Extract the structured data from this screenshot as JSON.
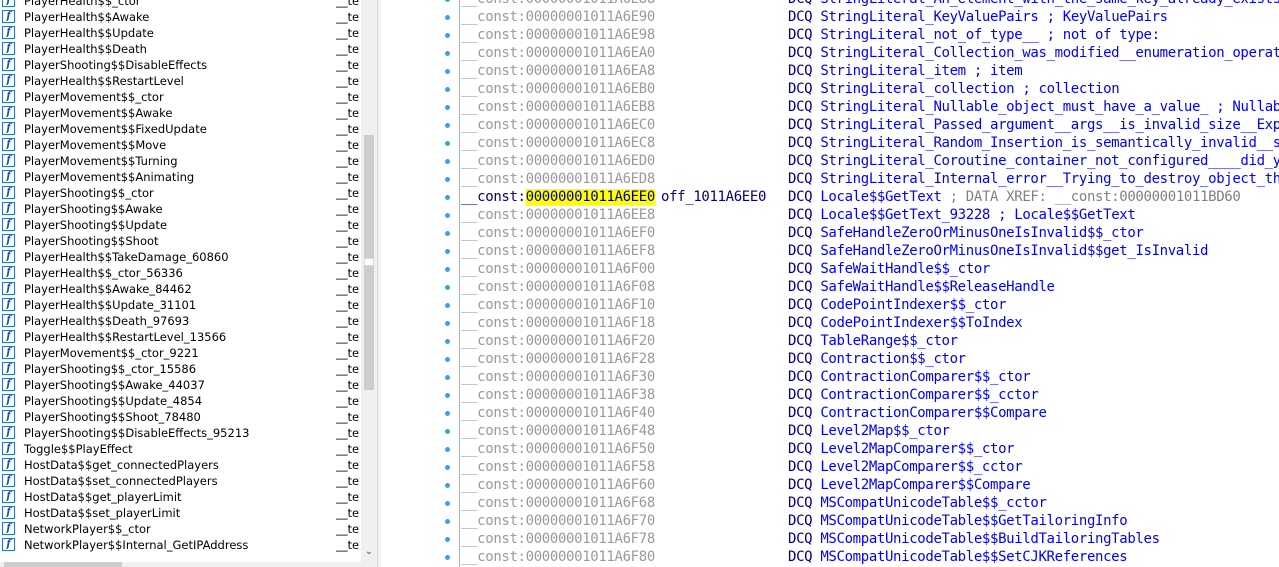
{
  "function_list": {
    "segment_label": "__te:",
    "items": [
      {
        "name": "PlayerHealth$$_ctor"
      },
      {
        "name": "PlayerHealth$$Awake"
      },
      {
        "name": "PlayerHealth$$Update"
      },
      {
        "name": "PlayerHealth$$Death"
      },
      {
        "name": "PlayerShooting$$DisableEffects"
      },
      {
        "name": "PlayerHealth$$RestartLevel"
      },
      {
        "name": "PlayerMovement$$_ctor"
      },
      {
        "name": "PlayerMovement$$Awake"
      },
      {
        "name": "PlayerMovement$$FixedUpdate"
      },
      {
        "name": "PlayerMovement$$Move"
      },
      {
        "name": "PlayerMovement$$Turning"
      },
      {
        "name": "PlayerMovement$$Animating"
      },
      {
        "name": "PlayerShooting$$_ctor"
      },
      {
        "name": "PlayerShooting$$Awake"
      },
      {
        "name": "PlayerShooting$$Update"
      },
      {
        "name": "PlayerShooting$$Shoot"
      },
      {
        "name": "PlayerHealth$$TakeDamage_60860"
      },
      {
        "name": "PlayerHealth$$_ctor_56336"
      },
      {
        "name": "PlayerHealth$$Awake_84462"
      },
      {
        "name": "PlayerHealth$$Update_31101"
      },
      {
        "name": "PlayerHealth$$Death_97693"
      },
      {
        "name": "PlayerHealth$$RestartLevel_13566"
      },
      {
        "name": "PlayerMovement$$_ctor_9221"
      },
      {
        "name": "PlayerShooting$$_ctor_15586"
      },
      {
        "name": "PlayerShooting$$Awake_44037"
      },
      {
        "name": "PlayerShooting$$Update_4854"
      },
      {
        "name": "PlayerShooting$$Shoot_78480"
      },
      {
        "name": "PlayerShooting$$DisableEffects_95213"
      },
      {
        "name": "Toggle$$PlayEffect"
      },
      {
        "name": "HostData$$get_connectedPlayers"
      },
      {
        "name": "HostData$$set_connectedPlayers"
      },
      {
        "name": "HostData$$get_playerLimit"
      },
      {
        "name": "HostData$$set_playerLimit"
      },
      {
        "name": "NetworkPlayer$$_ctor"
      },
      {
        "name": "NetworkPlayer$$Internal_GetIPAddress"
      }
    ]
  },
  "disassembly": {
    "rows": [
      {
        "seg": "__const:",
        "addr": "00000001011A6E88",
        "label": "",
        "op": "DCQ",
        "sym": "StringLiteral_An_element_with_the_same_key_already_exists",
        "comment": ""
      },
      {
        "seg": "__const:",
        "addr": "00000001011A6E90",
        "label": "",
        "op": "DCQ",
        "sym": "StringLiteral_KeyValuePairs",
        "comment": "; KeyValuePairs"
      },
      {
        "seg": "__const:",
        "addr": "00000001011A6E98",
        "label": "",
        "op": "DCQ",
        "sym": "StringLiteral_not_of_type__",
        "comment": "; not of type:"
      },
      {
        "seg": "__const:",
        "addr": "00000001011A6EA0",
        "label": "",
        "op": "DCQ",
        "sym": "StringLiteral_Collection_was_modified__enumeration_operat",
        "comment": ""
      },
      {
        "seg": "__const:",
        "addr": "00000001011A6EA8",
        "label": "",
        "op": "DCQ",
        "sym": "StringLiteral_item",
        "comment": " ; item"
      },
      {
        "seg": "__const:",
        "addr": "00000001011A6EB0",
        "label": "",
        "op": "DCQ",
        "sym": "StringLiteral_collection",
        "comment": "; collection"
      },
      {
        "seg": "__const:",
        "addr": "00000001011A6EB8",
        "label": "",
        "op": "DCQ",
        "sym": "StringLiteral_Nullable_object_must_have_a_value_",
        "comment": "; Nullab"
      },
      {
        "seg": "__const:",
        "addr": "00000001011A6EC0",
        "label": "",
        "op": "DCQ",
        "sym": "StringLiteral_Passed_argument__args__is_invalid_size__Expe",
        "comment": ""
      },
      {
        "seg": "__const:",
        "addr": "00000001011A6EC8",
        "label": "",
        "op": "DCQ",
        "sym": "StringLiteral_Random_Insertion_is_semantically_invalid__s",
        "comment": ""
      },
      {
        "seg": "__const:",
        "addr": "00000001011A6ED0",
        "label": "",
        "op": "DCQ",
        "sym": "StringLiteral_Coroutine_container_not_configured____did_y",
        "comment": ""
      },
      {
        "seg": "__const:",
        "addr": "00000001011A6ED8",
        "label": "",
        "op": "DCQ",
        "sym": "StringLiteral_Internal_error__Trying_to_destroy_object_th",
        "comment": ""
      },
      {
        "seg": "__const:",
        "addr": "00000001011A6EE0",
        "label": "off_1011A6EE0",
        "op": "DCQ",
        "sym": "Locale$$GetText",
        "comment": "",
        "xref": "; DATA XREF: __const:00000001011BD60",
        "selected": true
      },
      {
        "seg": "__const:",
        "addr": "00000001011A6EE8",
        "label": "",
        "op": "DCQ",
        "sym": "Locale$$GetText_93228",
        "comment": "; Locale$$GetText"
      },
      {
        "seg": "__const:",
        "addr": "00000001011A6EF0",
        "label": "",
        "op": "DCQ",
        "sym": "SafeHandleZeroOrMinusOneIsInvalid$$_ctor",
        "comment": ""
      },
      {
        "seg": "__const:",
        "addr": "00000001011A6EF8",
        "label": "",
        "op": "DCQ",
        "sym": "SafeHandleZeroOrMinusOneIsInvalid$$get_IsInvalid",
        "comment": ""
      },
      {
        "seg": "__const:",
        "addr": "00000001011A6F00",
        "label": "",
        "op": "DCQ",
        "sym": "SafeWaitHandle$$_ctor",
        "comment": ""
      },
      {
        "seg": "__const:",
        "addr": "00000001011A6F08",
        "label": "",
        "op": "DCQ",
        "sym": "SafeWaitHandle$$ReleaseHandle",
        "comment": ""
      },
      {
        "seg": "__const:",
        "addr": "00000001011A6F10",
        "label": "",
        "op": "DCQ",
        "sym": "CodePointIndexer$$_ctor",
        "comment": ""
      },
      {
        "seg": "__const:",
        "addr": "00000001011A6F18",
        "label": "",
        "op": "DCQ",
        "sym": "CodePointIndexer$$ToIndex",
        "comment": ""
      },
      {
        "seg": "__const:",
        "addr": "00000001011A6F20",
        "label": "",
        "op": "DCQ",
        "sym": "TableRange$$_ctor",
        "comment": ""
      },
      {
        "seg": "__const:",
        "addr": "00000001011A6F28",
        "label": "",
        "op": "DCQ",
        "sym": "Contraction$$_ctor",
        "comment": ""
      },
      {
        "seg": "__const:",
        "addr": "00000001011A6F30",
        "label": "",
        "op": "DCQ",
        "sym": "ContractionComparer$$_ctor",
        "comment": ""
      },
      {
        "seg": "__const:",
        "addr": "00000001011A6F38",
        "label": "",
        "op": "DCQ",
        "sym": "ContractionComparer$$_cctor",
        "comment": ""
      },
      {
        "seg": "__const:",
        "addr": "00000001011A6F40",
        "label": "",
        "op": "DCQ",
        "sym": "ContractionComparer$$Compare",
        "comment": ""
      },
      {
        "seg": "__const:",
        "addr": "00000001011A6F48",
        "label": "",
        "op": "DCQ",
        "sym": "Level2Map$$_ctor",
        "comment": ""
      },
      {
        "seg": "__const:",
        "addr": "00000001011A6F50",
        "label": "",
        "op": "DCQ",
        "sym": "Level2MapComparer$$_ctor",
        "comment": ""
      },
      {
        "seg": "__const:",
        "addr": "00000001011A6F58",
        "label": "",
        "op": "DCQ",
        "sym": "Level2MapComparer$$_cctor",
        "comment": ""
      },
      {
        "seg": "__const:",
        "addr": "00000001011A6F60",
        "label": "",
        "op": "DCQ",
        "sym": "Level2MapComparer$$Compare",
        "comment": ""
      },
      {
        "seg": "__const:",
        "addr": "00000001011A6F68",
        "label": "",
        "op": "DCQ",
        "sym": "MSCompatUnicodeTable$$_cctor",
        "comment": ""
      },
      {
        "seg": "__const:",
        "addr": "00000001011A6F70",
        "label": "",
        "op": "DCQ",
        "sym": "MSCompatUnicodeTable$$GetTailoringInfo",
        "comment": ""
      },
      {
        "seg": "__const:",
        "addr": "00000001011A6F78",
        "label": "",
        "op": "DCQ",
        "sym": "MSCompatUnicodeTable$$BuildTailoringTables",
        "comment": ""
      },
      {
        "seg": "__const:",
        "addr": "00000001011A6F80",
        "label": "",
        "op": "DCQ",
        "sym": "MSCompatUnicodeTable$$SetCJKReferences",
        "comment": ""
      }
    ]
  },
  "icons": {
    "function_icon": "f",
    "scroll_down_icon": "chevron-down"
  },
  "colors": {
    "address_gray": "#9a9a9a",
    "symbol_blue": "#0000ff",
    "highlight_yellow": "#ffff00",
    "instruction_navy": "#000080"
  }
}
